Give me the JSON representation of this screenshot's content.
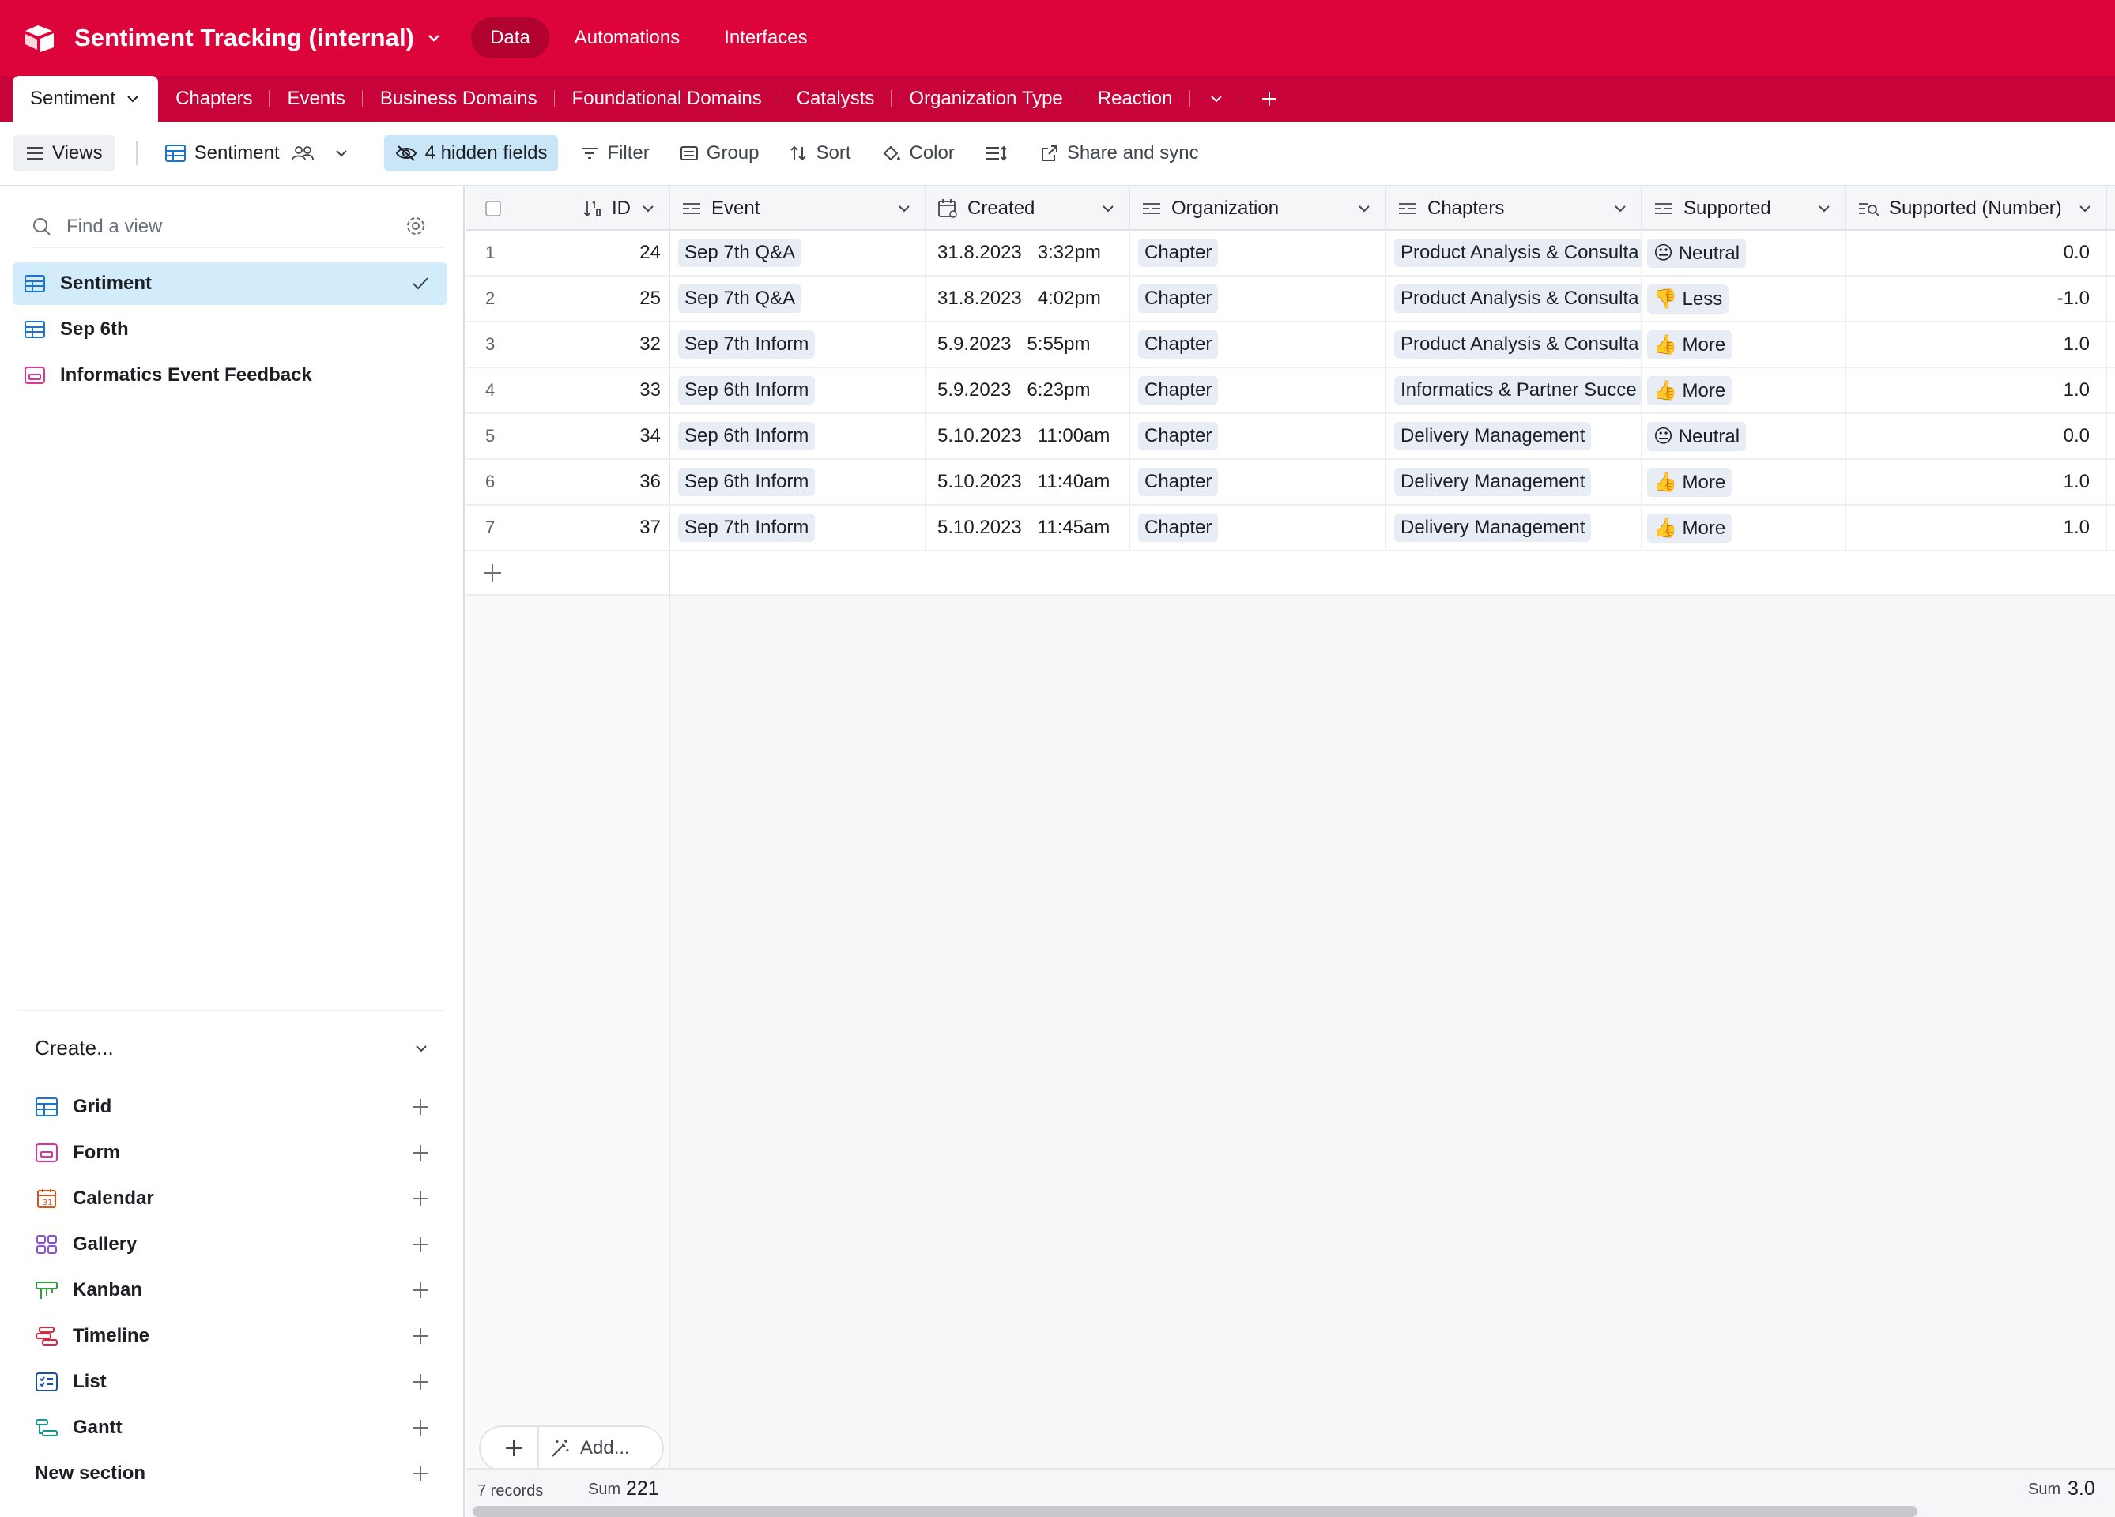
{
  "topbar": {
    "base_title": "Sentiment Tracking (internal)",
    "nav": [
      "Data",
      "Automations",
      "Interfaces"
    ],
    "accent": "#dc043b"
  },
  "tables": {
    "active": "Sentiment",
    "items": [
      "Chapters",
      "Events",
      "Business Domains",
      "Foundational Domains",
      "Catalysts",
      "Organization Type",
      "Reaction"
    ]
  },
  "viewbar": {
    "views_label": "Views",
    "current_view": "Sentiment",
    "hidden_fields": "4 hidden fields",
    "filter": "Filter",
    "group": "Group",
    "sort": "Sort",
    "color": "Color",
    "share": "Share and sync"
  },
  "sidebar": {
    "find_placeholder": "Find a view",
    "views": [
      {
        "label": "Sentiment",
        "icon": "grid-icon"
      },
      {
        "label": "Sep 6th",
        "icon": "grid-icon"
      },
      {
        "label": "Informatics Event Feedback",
        "icon": "form-icon"
      }
    ],
    "create_label": "Create...",
    "create_items": [
      "Grid",
      "Form",
      "Calendar",
      "Gallery",
      "Kanban",
      "Timeline",
      "List",
      "Gantt"
    ],
    "new_section": "New section"
  },
  "grid": {
    "columns": [
      "ID",
      "Event",
      "Created",
      "Organization",
      "Chapters",
      "Supported",
      "Supported (Number)"
    ],
    "rows": [
      {
        "n": "1",
        "id": "24",
        "event": "Sep 7th Q&A",
        "date": "31.8.2023",
        "time": "3:32pm",
        "org": "Chapter",
        "chapter": "Product Analysis & Consulta",
        "supported": "😐 Neutral",
        "num": "0.0"
      },
      {
        "n": "2",
        "id": "25",
        "event": "Sep 7th Q&A",
        "date": "31.8.2023",
        "time": "4:02pm",
        "org": "Chapter",
        "chapter": "Product Analysis & Consulta",
        "supported": "👎 Less",
        "num": "-1.0"
      },
      {
        "n": "3",
        "id": "32",
        "event": "Sep 7th Inform",
        "date": "5.9.2023",
        "time": "5:55pm",
        "org": "Chapter",
        "chapter": "Product Analysis & Consulta",
        "supported": "👍 More",
        "num": "1.0"
      },
      {
        "n": "4",
        "id": "33",
        "event": "Sep 6th Inform",
        "date": "5.9.2023",
        "time": "6:23pm",
        "org": "Chapter",
        "chapter": "Informatics & Partner Succe",
        "supported": "👍 More",
        "num": "1.0"
      },
      {
        "n": "5",
        "id": "34",
        "event": "Sep 6th Inform",
        "date": "5.10.2023",
        "time": "11:00am",
        "org": "Chapter",
        "chapter": "Delivery Management",
        "supported": "😐 Neutral",
        "num": "0.0"
      },
      {
        "n": "6",
        "id": "36",
        "event": "Sep 6th Inform",
        "date": "5.10.2023",
        "time": "11:40am",
        "org": "Chapter",
        "chapter": "Delivery Management",
        "supported": "👍 More",
        "num": "1.0"
      },
      {
        "n": "7",
        "id": "37",
        "event": "Sep 7th Inform",
        "date": "5.10.2023",
        "time": "11:45am",
        "org": "Chapter",
        "chapter": "Delivery Management",
        "supported": "👍 More",
        "num": "1.0"
      }
    ],
    "add_label": "Add...",
    "footer": {
      "records": "7 records",
      "sum_label": "Sum",
      "id_sum": "221",
      "num_sum": "3.0"
    }
  }
}
